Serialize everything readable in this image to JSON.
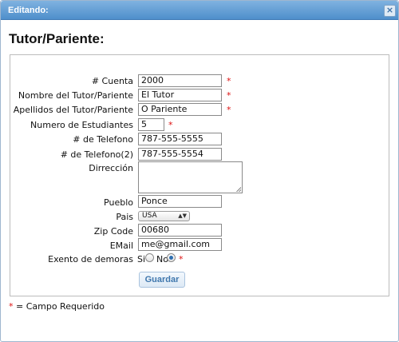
{
  "dialog": {
    "title": "Editando:",
    "close_icon": "×"
  },
  "heading": "Tutor/Pariente:",
  "required_marker": "*",
  "fields": {
    "cuenta": {
      "label": "# Cuenta",
      "value": "2000"
    },
    "nombre": {
      "label": "Nombre del Tutor/Pariente",
      "value": "El Tutor"
    },
    "apellidos": {
      "label": "Apellidos del Tutor/Pariente",
      "value": "O Pariente"
    },
    "estudiantes": {
      "label": "Numero de Estudiantes",
      "value": "5"
    },
    "telefono": {
      "label": "# de Telefono",
      "value": "787-555-5555"
    },
    "telefono2": {
      "label": "# de Telefono(2)",
      "value": "787-555-5554"
    },
    "direccion": {
      "label": "Dirrección",
      "value": ""
    },
    "pueblo": {
      "label": "Pueblo",
      "value": "Ponce"
    },
    "pais": {
      "label": "Pais",
      "selected": "USA"
    },
    "zip": {
      "label": "Zip Code",
      "value": "00680"
    },
    "email": {
      "label": "EMail",
      "value": "me@gmail.com"
    },
    "exento": {
      "label": "Exento de demoras",
      "option_si": "Si",
      "option_no": "No",
      "selected": "No"
    }
  },
  "save_button": "Guardar",
  "footnote": {
    "star": "*",
    "text": " = Campo Requerido"
  },
  "colors": {
    "titlebar": "#4f8fcb",
    "required": "#dd1111",
    "button_text": "#3f77ad"
  }
}
